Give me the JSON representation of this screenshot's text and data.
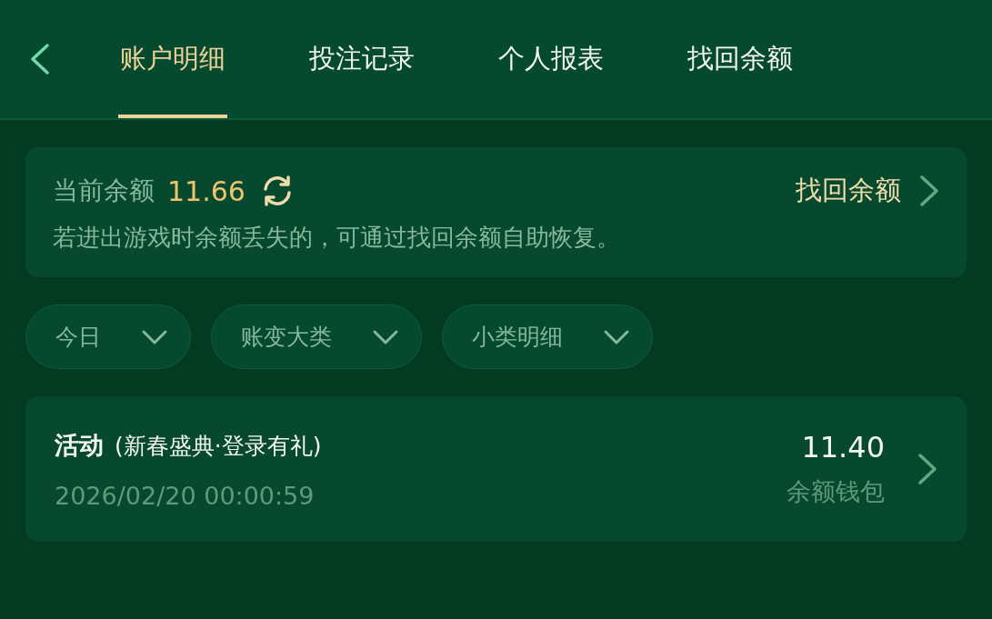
{
  "tabs": [
    {
      "label": "账户明细",
      "selected": true
    },
    {
      "label": "投注记录",
      "selected": false
    },
    {
      "label": "个人报表",
      "selected": false
    },
    {
      "label": "找回余额",
      "selected": false
    }
  ],
  "balance_card": {
    "label": "当前余额",
    "amount": "11.66",
    "recover_link": "找回余额",
    "note": "若进出游戏时余额丢失的，可通过找回余额自助恢复。"
  },
  "filters": [
    {
      "label": "今日"
    },
    {
      "label": "账变大类"
    },
    {
      "label": "小类明细"
    }
  ],
  "records": [
    {
      "type": "活动",
      "detail": "(新春盛典·登录有礼)",
      "time": "2026/02/20 00:00:59",
      "amount": "11.40",
      "wallet": "余额钱包"
    }
  ]
}
